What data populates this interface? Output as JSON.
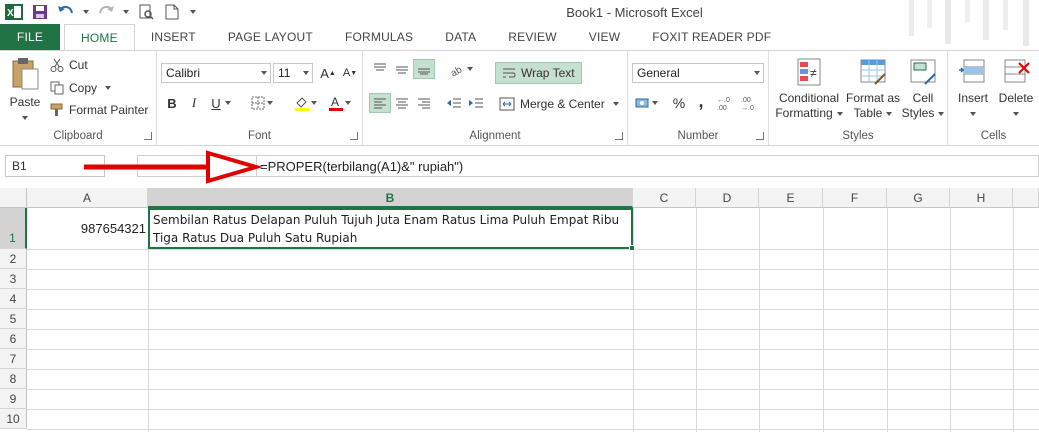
{
  "window": {
    "title": "Book1 - Microsoft Excel"
  },
  "tabs": [
    {
      "label": "FILE"
    },
    {
      "label": "HOME"
    },
    {
      "label": "INSERT"
    },
    {
      "label": "PAGE LAYOUT"
    },
    {
      "label": "FORMULAS"
    },
    {
      "label": "DATA"
    },
    {
      "label": "REVIEW"
    },
    {
      "label": "VIEW"
    },
    {
      "label": "FOXIT READER PDF"
    }
  ],
  "ribbon": {
    "clipboard": {
      "label": "Clipboard",
      "paste": "Paste",
      "cut": "Cut",
      "copy": "Copy",
      "format_painter": "Format Painter"
    },
    "font": {
      "label": "Font",
      "font_name": "Calibri",
      "font_size": "11",
      "bold": "B",
      "italic": "I",
      "underline": "U"
    },
    "alignment": {
      "label": "Alignment",
      "wrap_text": "Wrap Text",
      "merge_center": "Merge & Center"
    },
    "number": {
      "label": "Number",
      "format": "General",
      "percent": "%",
      "comma": ","
    },
    "styles": {
      "label": "Styles",
      "conditional_line1": "Conditional",
      "conditional_line2": "Formatting",
      "format_table_line1": "Format as",
      "format_table_line2": "Table",
      "cell_styles_line1": "Cell",
      "cell_styles_line2": "Styles"
    },
    "cells": {
      "label": "Cells",
      "insert": "Insert",
      "delete": "Delete"
    }
  },
  "formula_bar": {
    "name_box": "B1",
    "formula": "=PROPER(terbilang(A1)&\" rupiah\")"
  },
  "sheet": {
    "columns": [
      "A",
      "B",
      "C",
      "D",
      "E",
      "F",
      "G",
      "H"
    ],
    "rows": [
      "1",
      "2",
      "3",
      "4",
      "5",
      "6",
      "7",
      "8",
      "9",
      "10"
    ],
    "A1": "987654321",
    "B1": "Sembilan Ratus Delapan Puluh Tujuh Juta Enam Ratus Lima Puluh Empat Ribu\nTiga Ratus Dua Puluh Satu Rupiah"
  },
  "colors": {
    "accent": "#217346",
    "annotation": "#e00000"
  }
}
